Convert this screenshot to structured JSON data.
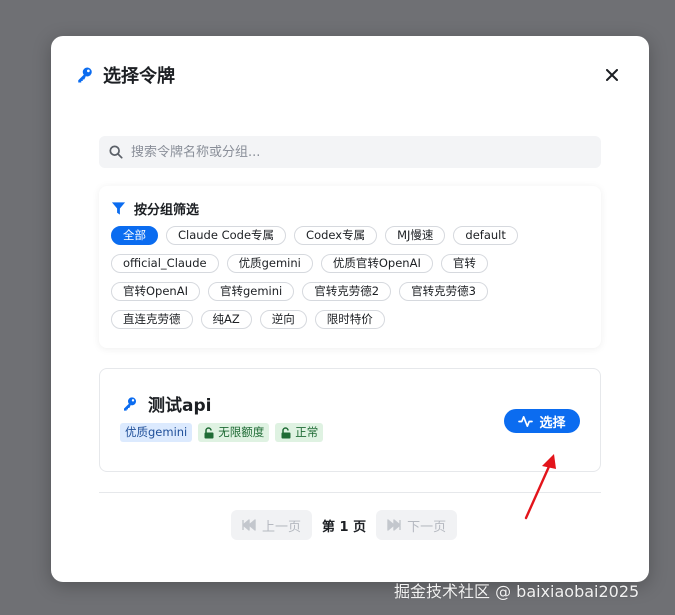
{
  "modal": {
    "title": "选择令牌",
    "close_icon": "close-icon"
  },
  "search": {
    "placeholder": "搜索令牌名称或分组..."
  },
  "filter": {
    "title": "按分组筛选",
    "tags": [
      {
        "label": "全部",
        "active": true
      },
      {
        "label": "Claude Code专属"
      },
      {
        "label": "Codex专属"
      },
      {
        "label": "MJ慢速"
      },
      {
        "label": "default"
      },
      {
        "label": "official_Claude"
      },
      {
        "label": "优质gemini"
      },
      {
        "label": "优质官转OpenAI"
      },
      {
        "label": "官转"
      },
      {
        "label": "官转OpenAI"
      },
      {
        "label": "官转gemini"
      },
      {
        "label": "官转克劳德2"
      },
      {
        "label": "官转克劳德3"
      },
      {
        "label": "直连克劳德"
      },
      {
        "label": "纯AZ"
      },
      {
        "label": "逆向"
      },
      {
        "label": "限时特价"
      }
    ]
  },
  "token": {
    "name": "测试api",
    "group_badge": "优质gemini",
    "quota_badge": "无限额度",
    "status_badge": "正常",
    "select_label": "选择"
  },
  "pager": {
    "prev_label": "上一页",
    "current_label": "第 1 页",
    "next_label": "下一页"
  },
  "watermark": "掘金技术社区 @ baixiaobai2025",
  "colors": {
    "accent": "#0b6cf0",
    "overlay": "#6f7074",
    "arrow": "#e3141b"
  }
}
